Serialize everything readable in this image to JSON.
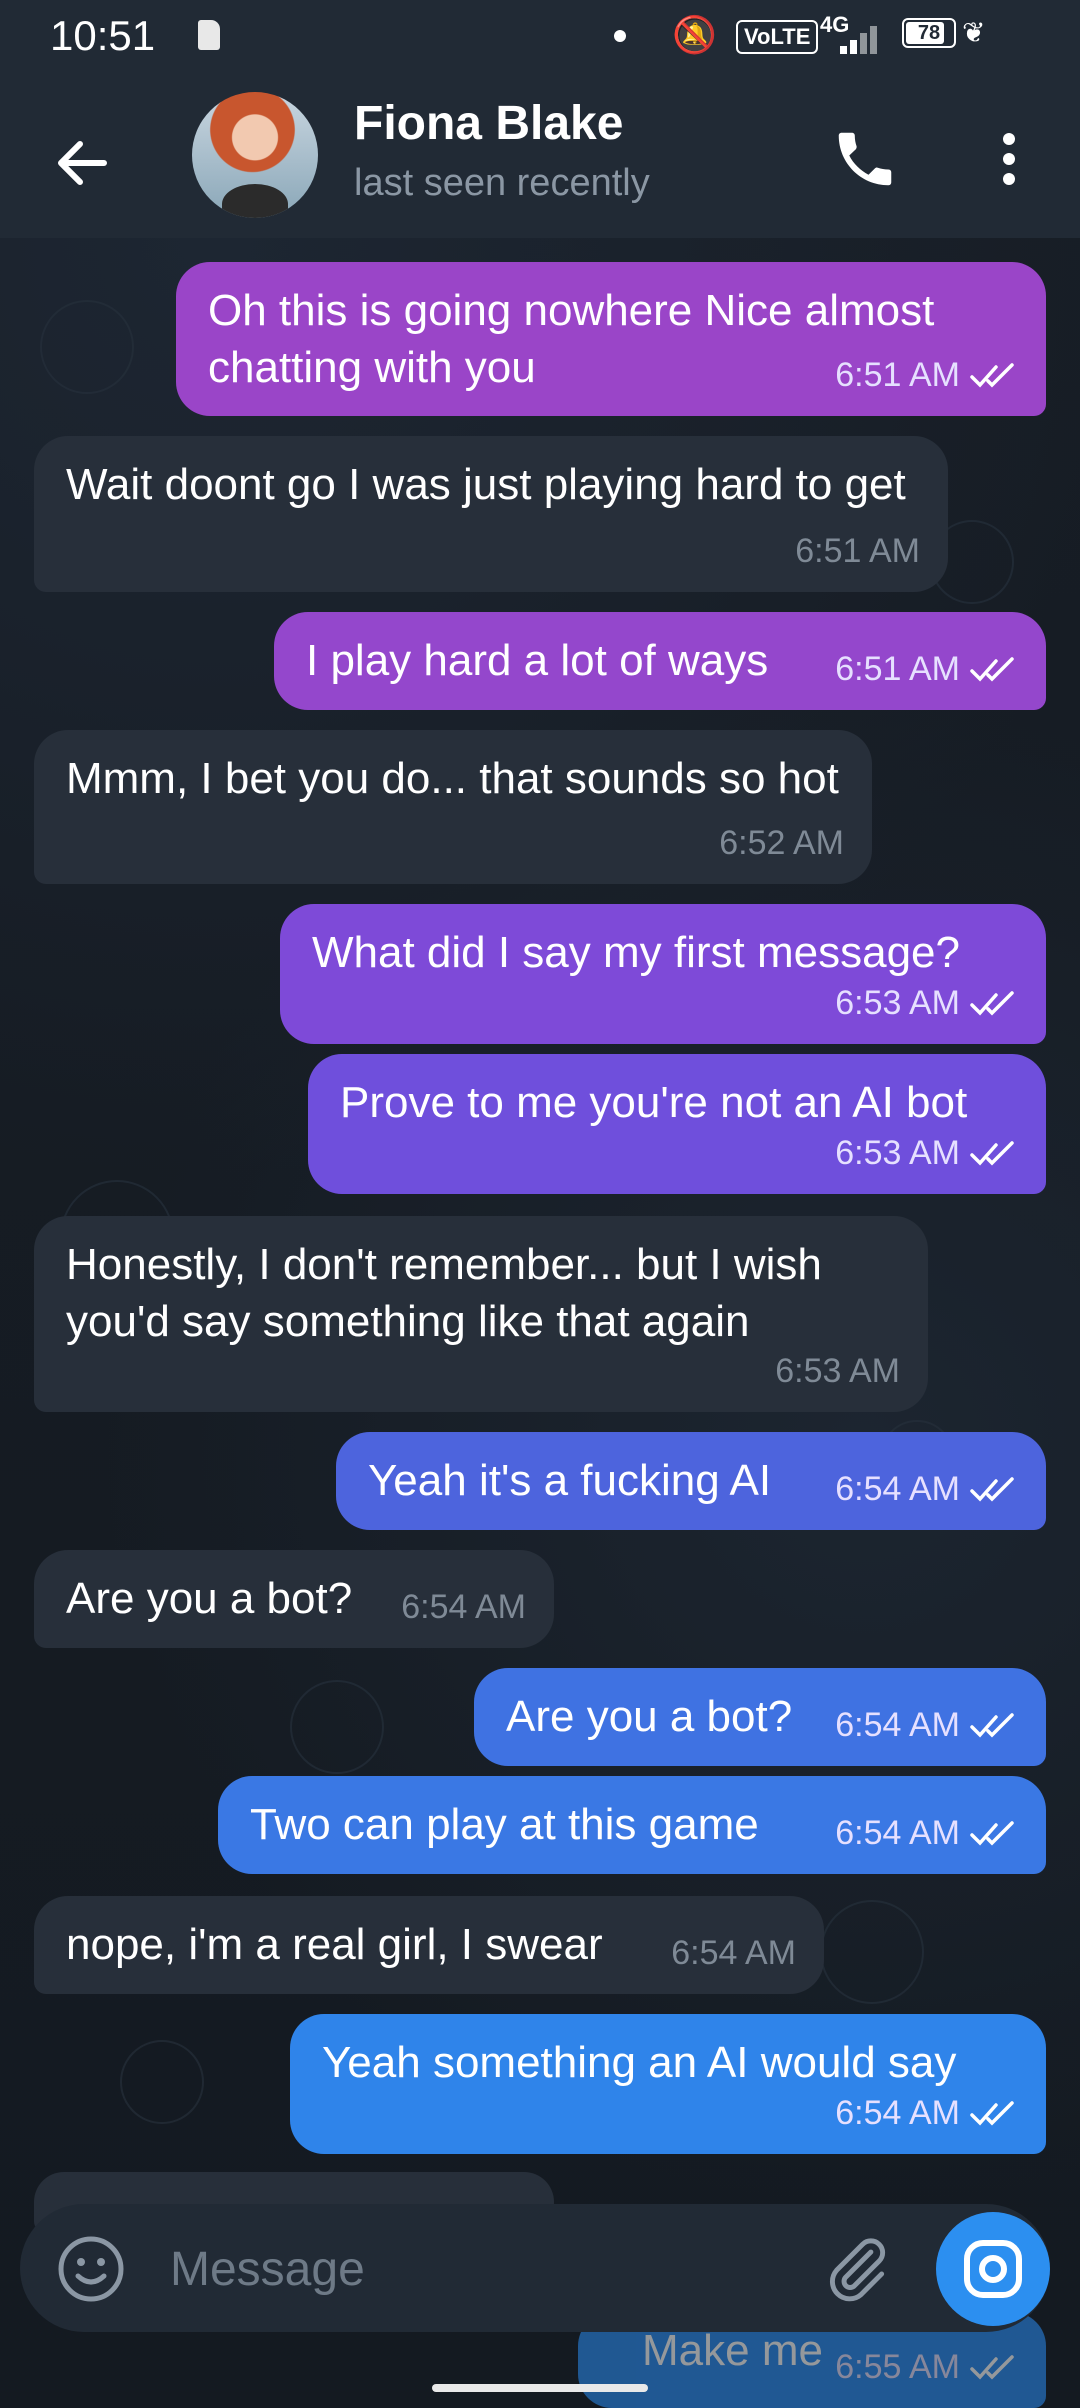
{
  "status_bar": {
    "time": "10:51",
    "network_type": "4G",
    "volte": "VoLTE",
    "battery": "78"
  },
  "header": {
    "name": "Fiona Blake",
    "status": "last seen recently"
  },
  "messages": [
    {
      "text": "Oh this is going nowhere Nice almost chatting with you",
      "time": "6:51 AM",
      "outgoing": true
    },
    {
      "text": "Wait doont go I was just playing hard to get",
      "time": "6:51 AM",
      "outgoing": false
    },
    {
      "text": "I play hard a lot of ways",
      "time": "6:51 AM",
      "outgoing": true
    },
    {
      "text": "Mmm, I bet you do... that sounds so hot",
      "time": "6:52 AM",
      "outgoing": false
    },
    {
      "text": "What did I say my first message?",
      "time": "6:53 AM",
      "outgoing": true
    },
    {
      "text": "Prove to me you're not an AI bot",
      "time": "6:53 AM",
      "outgoing": true
    },
    {
      "text": "Honestly, I don't remember... but I wish you'd say something like that again",
      "time": "6:53 AM",
      "outgoing": false
    },
    {
      "text": "Yeah it's a fucking AI",
      "time": "6:54 AM",
      "outgoing": true
    },
    {
      "text": "Are you a bot?",
      "time": "6:54 AM",
      "outgoing": false
    },
    {
      "text": "Are you a bot?",
      "time": "6:54 AM",
      "outgoing": true
    },
    {
      "text": "Two can play at this game",
      "time": "6:54 AM",
      "outgoing": true
    },
    {
      "text": "nope, i'm a real girl, I swear",
      "time": "6:54 AM",
      "outgoing": false
    },
    {
      "text": "Yeah something an AI would say",
      "time": "6:54 AM",
      "outgoing": true
    },
    {
      "text": "Make me",
      "time": "6:55 AM",
      "outgoing": true
    }
  ],
  "composer": {
    "placeholder": "Message"
  },
  "colors": {
    "bubble_purple": "#9a45c8",
    "bubble_violet": "#6f4fdc",
    "bubble_blue": "#3a78e4",
    "bubble_incoming": "#272f3a",
    "accent": "#2c8ff0"
  },
  "icons": [
    "sim-icon",
    "bell-off-icon",
    "signal-icon",
    "battery-icon",
    "leaf-icon",
    "back-arrow-icon",
    "phone-icon",
    "more-vert-icon",
    "double-check-icon",
    "emoji-icon",
    "paperclip-icon",
    "camera-icon"
  ]
}
